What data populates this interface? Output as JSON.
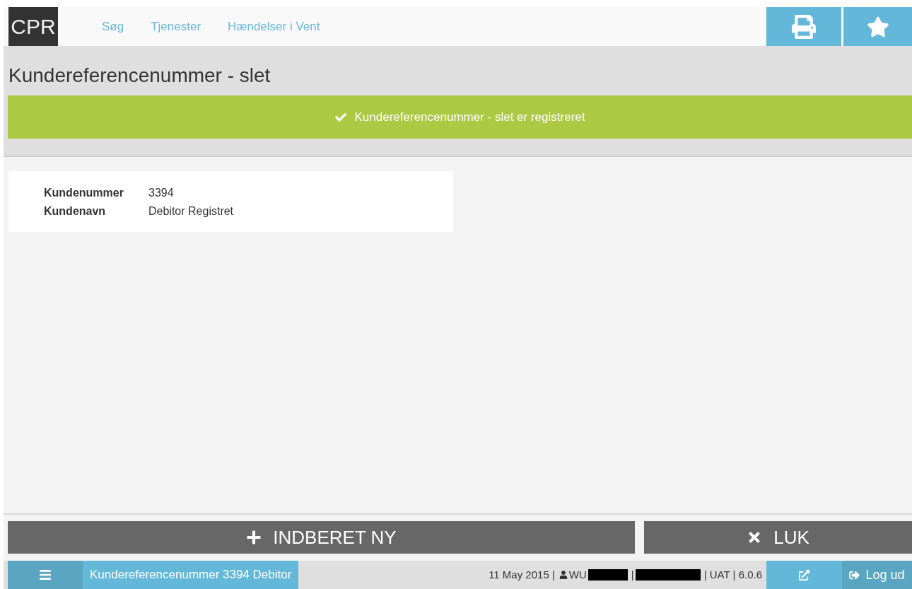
{
  "header": {
    "logo": "CPR",
    "nav": [
      "Søg",
      "Tjenester",
      "Hændelser i Vent"
    ]
  },
  "page_title": "Kundereferencenummer - slet",
  "success_banner": "Kundereferencenummer - slet er registreret",
  "details": [
    {
      "label": "Kundenummer",
      "value": "3394"
    },
    {
      "label": "Kundenavn",
      "value": "Debitor Registret"
    }
  ],
  "actions": [
    {
      "kind": "add",
      "label": "INDBERET NY"
    },
    {
      "kind": "close",
      "label": "LUK"
    }
  ],
  "status_bar": {
    "context": "Kundereferencenummer 3394 Debitor",
    "date": "11 May 2015 |",
    "user": "WU",
    "separator": "|",
    "env": "| UAT | 6.0.6",
    "logout": "Log ud"
  }
}
